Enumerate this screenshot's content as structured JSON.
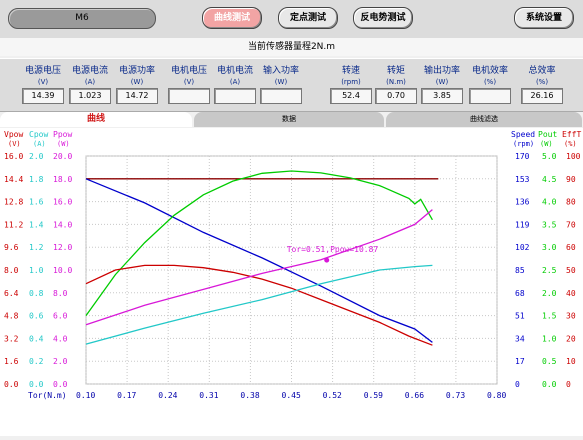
{
  "toolbar": {
    "title": "M6",
    "buttons": [
      "曲线测试",
      "定点测试",
      "反电势测试",
      "系统设置"
    ]
  },
  "sensor_range": "当前传感器量程2N.m",
  "fields": [
    {
      "label": "电源电压",
      "unit": "(V)",
      "value": "14.39"
    },
    {
      "label": "电源电流",
      "unit": "(A)",
      "value": "1.023"
    },
    {
      "label": "电源功率",
      "unit": "(W)",
      "value": "14.72"
    },
    {
      "label": "电机电压",
      "unit": "(V)",
      "value": ""
    },
    {
      "label": "电机电流",
      "unit": "(A)",
      "value": ""
    },
    {
      "label": "输入功率",
      "unit": "(W)",
      "value": ""
    },
    {
      "label": "转速",
      "unit": "(rpm)",
      "value": "52.4"
    },
    {
      "label": "转矩",
      "unit": "(N.m)",
      "value": "0.70"
    },
    {
      "label": "输出功率",
      "unit": "(W)",
      "value": "3.85"
    },
    {
      "label": "电机效率",
      "unit": "(%)",
      "value": ""
    },
    {
      "label": "总效率",
      "unit": "(%)",
      "value": "26.16"
    }
  ],
  "tabs": [
    "曲线",
    "数据",
    "曲线滤选"
  ],
  "colors": {
    "vpow": "#cc0000",
    "cpow": "#22c8c8",
    "ppow": "#d818d8",
    "speed": "#0000cc",
    "pout": "#00cc00",
    "efft": "#cc0000",
    "flat": "#8b0000"
  },
  "chart_data": {
    "type": "line",
    "xlabel": "Tor(N.m)",
    "x_ticks": [
      "0.10",
      "0.17",
      "0.24",
      "0.31",
      "0.38",
      "0.45",
      "0.52",
      "0.59",
      "0.66",
      "0.73",
      "0.80"
    ],
    "xlim": [
      0.1,
      0.8
    ],
    "annotation": "Tor=0.51,Ppow=10.87",
    "left_axes": [
      {
        "name": "Vpow",
        "unit": "(V)",
        "ticks": [
          "16.0",
          "14.4",
          "12.8",
          "11.2",
          "9.6",
          "8.0",
          "6.4",
          "4.8",
          "3.2",
          "1.6",
          "0.0"
        ]
      },
      {
        "name": "Cpow",
        "unit": "(A)",
        "ticks": [
          "2.0",
          "1.8",
          "1.6",
          "1.4",
          "1.2",
          "1.0",
          "0.8",
          "0.6",
          "0.4",
          "0.2",
          "0.0"
        ]
      },
      {
        "name": "Ppow",
        "unit": "(W)",
        "ticks": [
          "20.0",
          "18.0",
          "16.0",
          "14.0",
          "12.0",
          "10.0",
          "8.0",
          "6.0",
          "4.0",
          "2.0",
          "0.0"
        ]
      }
    ],
    "right_axes": [
      {
        "name": "Speed",
        "unit": "(rpm)",
        "ticks": [
          "170",
          "153",
          "136",
          "119",
          "102",
          "85",
          "68",
          "51",
          "34",
          "17",
          "0"
        ]
      },
      {
        "name": "Pout",
        "unit": "(W)",
        "ticks": [
          "5.0",
          "4.5",
          "4.0",
          "3.5",
          "3.0",
          "2.5",
          "2.0",
          "1.5",
          "1.0",
          "0.5",
          "0.0"
        ]
      },
      {
        "name": "EffT",
        "unit": "(%)",
        "ticks": [
          "100",
          "90",
          "80",
          "70",
          "60",
          "50",
          "40",
          "30",
          "20",
          "10",
          "0"
        ]
      }
    ],
    "series": [
      {
        "name": "Vpow",
        "ymax": 16,
        "x": [
          0.1,
          0.7
        ],
        "y": [
          14.4,
          14.4
        ]
      },
      {
        "name": "Speed",
        "ymax": 170,
        "x": [
          0.1,
          0.2,
          0.3,
          0.4,
          0.5,
          0.6,
          0.66,
          0.69
        ],
        "y": [
          153,
          135,
          113,
          94,
          73,
          51,
          41,
          31
        ]
      },
      {
        "name": "Pout",
        "ymax": 5.0,
        "x": [
          0.1,
          0.15,
          0.2,
          0.25,
          0.3,
          0.35,
          0.4,
          0.45,
          0.5,
          0.55,
          0.6,
          0.65,
          0.66,
          0.67,
          0.69
        ],
        "y": [
          1.5,
          2.4,
          3.1,
          3.7,
          4.15,
          4.45,
          4.62,
          4.67,
          4.63,
          4.52,
          4.35,
          4.07,
          3.95,
          4.05,
          3.6
        ]
      },
      {
        "name": "EffT",
        "ymax": 100,
        "x": [
          0.1,
          0.15,
          0.2,
          0.25,
          0.3,
          0.35,
          0.4,
          0.45,
          0.5,
          0.55,
          0.6,
          0.65,
          0.69
        ],
        "y": [
          44,
          50,
          52,
          52,
          51,
          49,
          46,
          42,
          37,
          32,
          27,
          21,
          17
        ]
      },
      {
        "name": "Ppow",
        "ymax": 20,
        "x": [
          0.1,
          0.2,
          0.3,
          0.4,
          0.5,
          0.6,
          0.66,
          0.69
        ],
        "y": [
          5.2,
          6.9,
          8.3,
          9.7,
          10.9,
          12.7,
          14.0,
          15.3
        ]
      },
      {
        "name": "Cpow",
        "ymax": 2.0,
        "x": [
          0.1,
          0.2,
          0.3,
          0.4,
          0.5,
          0.6,
          0.66,
          0.69
        ],
        "y": [
          0.35,
          0.49,
          0.62,
          0.74,
          0.88,
          1.0,
          1.03,
          1.04
        ]
      }
    ]
  }
}
